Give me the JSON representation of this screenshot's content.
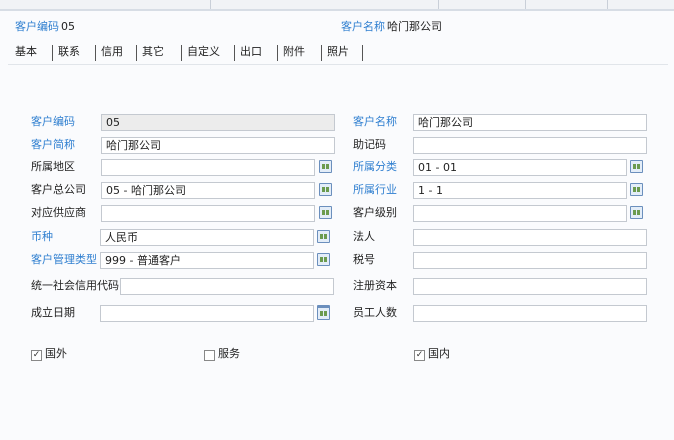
{
  "header": {
    "code_label": "客户编码",
    "code_value": "05",
    "name_label": "客户名称",
    "name_value": "哈门那公司"
  },
  "tabs": [
    "基本",
    "联系",
    "信用",
    "其它",
    "自定义",
    "出口",
    "附件",
    "照片"
  ],
  "left_fields": [
    {
      "label": "客户编码",
      "value": "05"
    },
    {
      "label": "客户简称",
      "value": "哈门那公司"
    },
    {
      "label": "所属地区",
      "value": ""
    },
    {
      "label": "客户总公司",
      "value": "05 - 哈门那公司"
    },
    {
      "label": "对应供应商",
      "value": ""
    },
    {
      "label": "币种",
      "value": "人民币"
    },
    {
      "label": "客户管理类型",
      "value": "999 - 普通客户"
    },
    {
      "label": "统一社会信用代码",
      "value": ""
    },
    {
      "label": "成立日期",
      "value": ""
    }
  ],
  "right_fields": [
    {
      "label": "客户名称",
      "value": "哈门那公司"
    },
    {
      "label": "助记码",
      "value": ""
    },
    {
      "label": "所属分类",
      "value": "01 - 01"
    },
    {
      "label": "所属行业",
      "value": "1 - 1"
    },
    {
      "label": "客户级别",
      "value": ""
    },
    {
      "label": "法人",
      "value": ""
    },
    {
      "label": "税号",
      "value": ""
    },
    {
      "label": "注册资本",
      "value": ""
    },
    {
      "label": "员工人数",
      "value": ""
    }
  ],
  "checkboxes": [
    {
      "label": "国外",
      "checked": true
    },
    {
      "label": "服务",
      "checked": false
    },
    {
      "label": "国内",
      "checked": true
    }
  ]
}
